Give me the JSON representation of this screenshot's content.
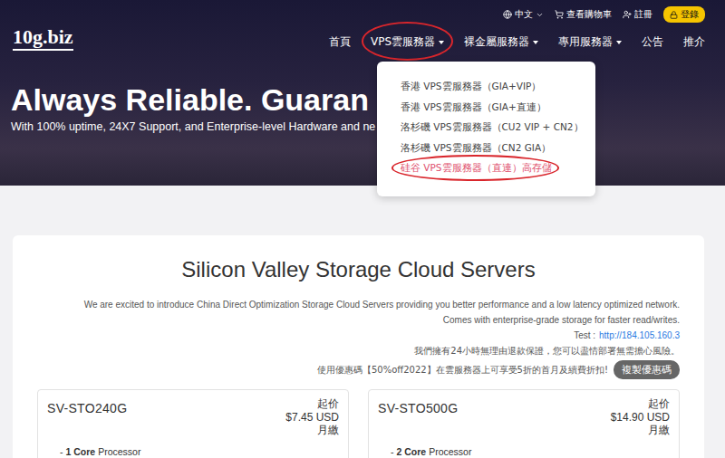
{
  "logo": {
    "text": "10g.biz"
  },
  "topbar": {
    "language": "中文",
    "cart": "查看購物車",
    "register": "註冊",
    "login": "登錄"
  },
  "nav": [
    {
      "label": "首頁",
      "dropdown": false,
      "expanded": false,
      "circled": false
    },
    {
      "label": "VPS雲服務器",
      "dropdown": true,
      "expanded": true,
      "circled": true
    },
    {
      "label": "裸金屬服務器",
      "dropdown": true,
      "expanded": false,
      "circled": false
    },
    {
      "label": "專用服務器",
      "dropdown": true,
      "expanded": false,
      "circled": false
    },
    {
      "label": "公告",
      "dropdown": false,
      "expanded": false,
      "circled": false
    },
    {
      "label": "推介",
      "dropdown": false,
      "expanded": false,
      "circled": false
    }
  ],
  "menu": {
    "items": [
      {
        "label": "香港 VPS雲服務器（GIA+VIP）",
        "selected": false,
        "circled": false
      },
      {
        "label": "香港 VPS雲服務器（GIA+直連）",
        "selected": false,
        "circled": false
      },
      {
        "label": "洛杉磯 VPS雲服務器（CU2 VIP + CN2）",
        "selected": false,
        "circled": false
      },
      {
        "label": "洛杉磯 VPS雲服務器（CN2 GIA）",
        "selected": false,
        "circled": false
      },
      {
        "label": "硅谷 VPS雲服務器（直連）高存儲",
        "selected": true,
        "circled": true
      }
    ]
  },
  "hero": {
    "heading": "Always Reliable. Guaran",
    "subtitle": "With 100% uptime, 24X7 Support, and Enterprise-level Hardware and ne"
  },
  "section": {
    "title": "Silicon Valley Storage Cloud Servers",
    "lines": [
      "We are excited to introduce China Direct Optimization Storage Cloud Servers providing you better performance and a low latency optimized network.",
      "Comes with enterprise-grade storage for faster read/writes."
    ],
    "test": {
      "label": "Test :",
      "link": "http://184.105.160.3"
    },
    "guarantee": "我們擁有24小時無理由退款保證，您可以盡情部署無需擔心風險。",
    "promo": "使用優惠碼【50%off2022】在雲服務器上可享受5折的首月及續費折扣!",
    "copy_button": "複製優惠碼"
  },
  "products": [
    {
      "name": "SV-STO240G",
      "from": "起价",
      "price": "$7.45 USD",
      "period": "月繳",
      "features": [
        {
          "dash": "-",
          "bold": "1 Core",
          "text": "Processor"
        }
      ]
    },
    {
      "name": "SV-STO500G",
      "from": "起价",
      "price": "$14.90 USD",
      "period": "月繳",
      "features": [
        {
          "dash": "-",
          "bold": "2 Core",
          "text": "Processor"
        }
      ]
    }
  ]
}
